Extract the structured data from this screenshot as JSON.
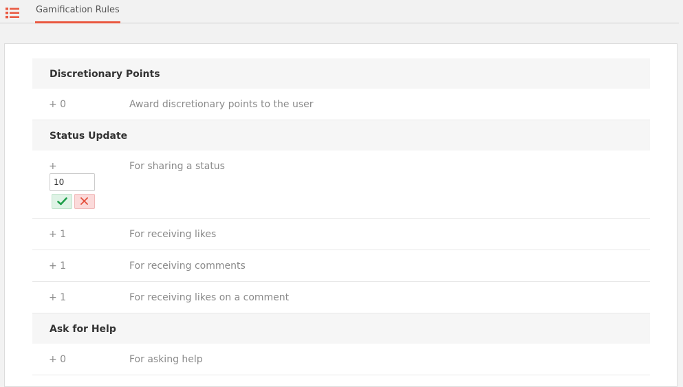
{
  "header": {
    "tab_label": "Gamification Rules"
  },
  "colors": {
    "accent": "#e9573f",
    "ok": "#1e9e4a",
    "cancel": "#e4503d"
  },
  "sections": [
    {
      "title": "Discretionary Points",
      "rules": [
        {
          "points": "+ 0",
          "description": "Award discretionary points to the user"
        }
      ]
    },
    {
      "title": "Status Update",
      "editing_rule": {
        "prefix": "+",
        "value": "10",
        "description": "For sharing a status"
      },
      "rules": [
        {
          "points": "+ 1",
          "description": "For receiving likes"
        },
        {
          "points": "+ 1",
          "description": "For receiving comments"
        },
        {
          "points": "+ 1",
          "description": "For receiving likes on a comment"
        }
      ]
    },
    {
      "title": "Ask for Help",
      "rules": [
        {
          "points": "+ 0",
          "description": "For asking help"
        }
      ]
    }
  ]
}
